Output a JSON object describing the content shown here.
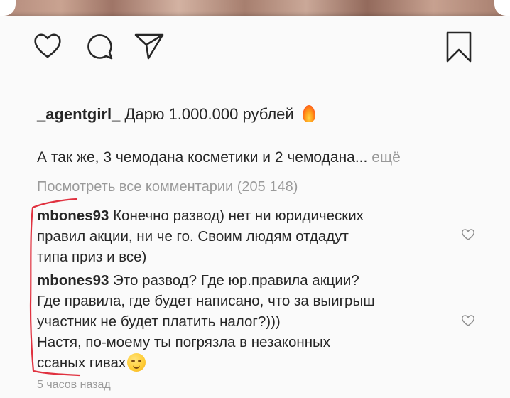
{
  "post": {
    "caption": {
      "username": "_agentgirl_",
      "text": "Дарю 1.000.000 рублей",
      "emoji": "fire",
      "continuation": "А так же, 3 чемодана косметики и 2 чемодана...",
      "more_label": "ещё"
    },
    "view_all_comments": "Посмотреть все комментарии (205 148)",
    "comments": [
      {
        "author": "mbones93",
        "lines": [
          "Конечно развод) нет ни юридических",
          "правил акции, ни че го. Своим людям отдадут",
          "типа приз и все)"
        ]
      },
      {
        "author": "mbones93",
        "lines": [
          "Это развод? Где юр.правила акции?",
          "Где правила, где будет написано, что за выигрыш",
          "участник не будет платить налог?)))",
          "Настя, по-моему ты погрязла в незаконных",
          "ссаных гивах"
        ],
        "emoji": "smirk"
      }
    ],
    "timestamp": "5 часов назад"
  },
  "icons": [
    "heart-icon",
    "comment-icon",
    "share-icon",
    "bookmark-icon",
    "comment-like-heart-icon"
  ],
  "colors": {
    "text": "#262626",
    "muted": "#9a9a9a",
    "annotation": "#e0313f"
  }
}
